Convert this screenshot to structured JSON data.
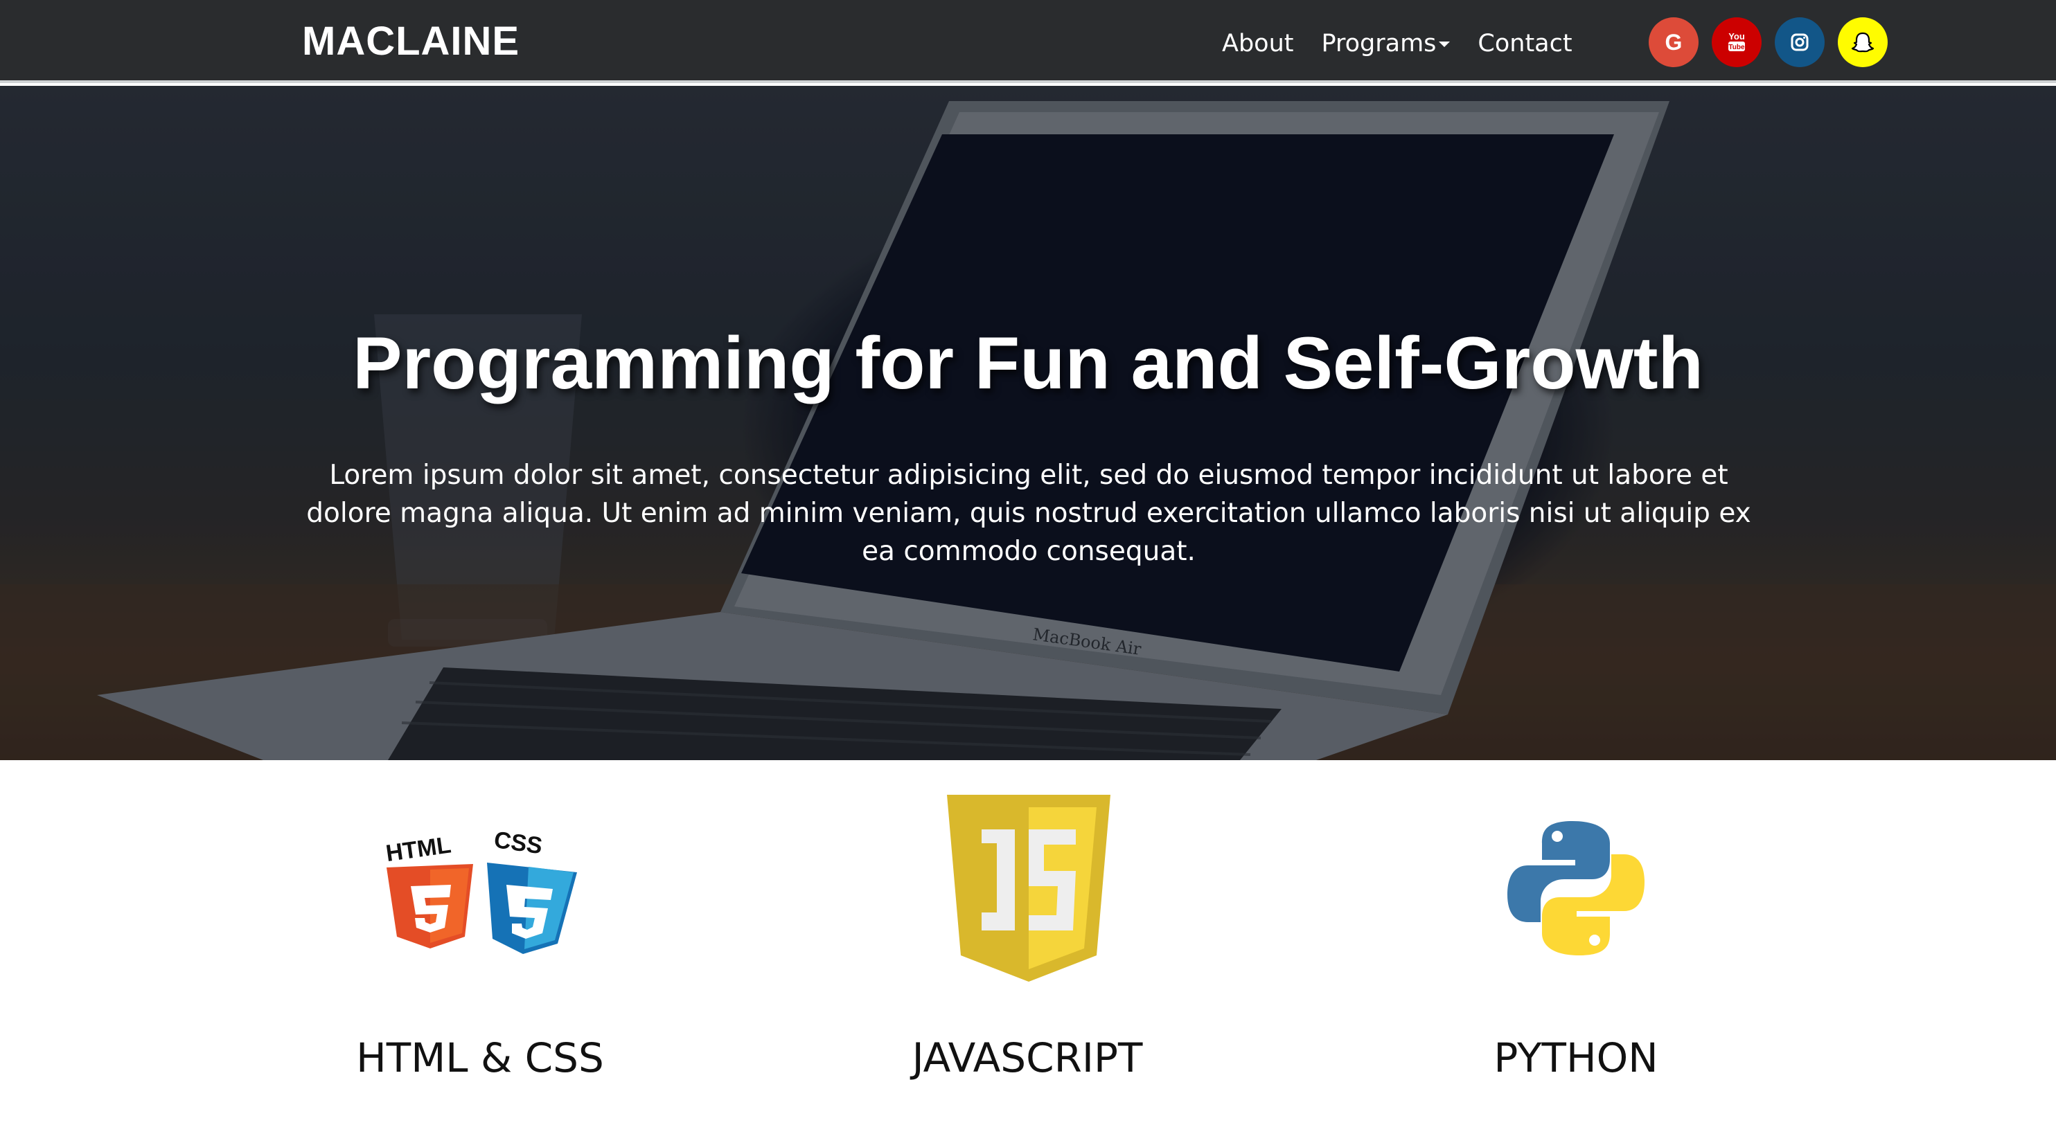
{
  "navbar": {
    "brand": "MACLAINE",
    "links": [
      {
        "label": "About"
      },
      {
        "label": "Programs"
      },
      {
        "label": "Contact"
      }
    ],
    "socials": [
      {
        "name": "google",
        "glyph": "G",
        "color": "#dd4b39"
      },
      {
        "name": "youtube",
        "glyph": "You Tube",
        "color": "#cc0000"
      },
      {
        "name": "instagram",
        "glyph": "instagram",
        "color": "#125688"
      },
      {
        "name": "snapchat",
        "glyph": "ghost",
        "color": "#fffc00"
      }
    ]
  },
  "hero": {
    "title": "Programming for Fun and Self-Growth",
    "text": "Lorem ipsum dolor sit amet, consectetur adipisicing elit, sed do eiusmod tempor incididunt ut labore et dolore magna aliqua. Ut enim ad minim veniam, quis nostrud exercitation ullamco laboris nisi ut aliquip ex ea commodo consequat.",
    "laptop_brand": "MacBook Air"
  },
  "features": [
    {
      "title": "HTML & CSS",
      "logo": {
        "html_label": "HTML",
        "css_label": "CSS"
      }
    },
    {
      "title": "JAVASCRIPT",
      "logo": {
        "label": "JS"
      }
    },
    {
      "title": "PYTHON",
      "logo": {
        "label": "python"
      }
    }
  ]
}
